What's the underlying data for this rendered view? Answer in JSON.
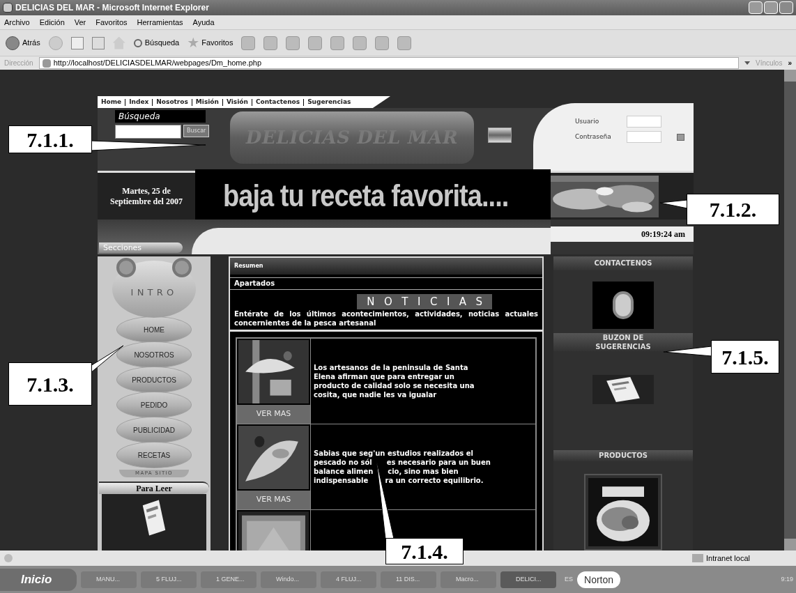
{
  "window": {
    "title": "DELICIAS DEL MAR - Microsoft Internet Explorer"
  },
  "menu": [
    "Archivo",
    "Edición",
    "Ver",
    "Favoritos",
    "Herramientas",
    "Ayuda"
  ],
  "toolbar": {
    "back": "Atrás",
    "search": "Búsqueda",
    "favorites": "Favoritos"
  },
  "address": {
    "label": "Dirección",
    "url": "http://localhost/DELICIASDELMAR/webpages/Dm_home.php",
    "links": "Vínculos",
    "more": "»"
  },
  "page": {
    "nav": [
      "Home",
      "Index",
      "Nosotros",
      "Misión",
      "Visión",
      "Contactenos",
      "Sugerencias"
    ],
    "search": {
      "title": "Búsqueda",
      "button": "Buscar"
    },
    "logo": "DELICIAS DEL MAR",
    "login": {
      "user_label": "Usuario",
      "password_label": "Contraseña"
    },
    "date": [
      "Martes, 25 de",
      "Septiembre del 2007"
    ],
    "slogan": "baja tu receta favorita....",
    "sections_tab": "Secciones",
    "time": "09:19:24 am",
    "side_menu": {
      "title": "INTRO",
      "items": [
        "HOME",
        "NOSOTROS",
        "PRODUCTOS",
        "PEDIDO",
        "PUBLICIDAD",
        "RECETAS"
      ],
      "footer": "MAPA SITIO"
    },
    "reading_title": "Para Leer",
    "summary": "Resumen",
    "subtitle": "Apartados",
    "news_title": "NOTICIAS",
    "intro": "Entérate de los últimos acontecimientos, actividades, noticias actuales concernientes de la pesca artesanal",
    "news": [
      {
        "kind": "article",
        "lines": [
          "Los artesanos de la peninsula de Santa",
          "Elena afirman que para entregar un",
          "producto de calidad solo se necesita una",
          "cosita, que nadie les va igualar"
        ],
        "more": "VER MAS"
      },
      {
        "kind": "article",
        "lines": [
          "Sabias que seg'un estudios realizados el",
          "pescado no sól      es necesario para un buen",
          "balance alimen      cio, sino mas bien",
          "indispensable       ra un correcto equilibrio."
        ],
        "more": "VER MAS"
      },
      {
        "kind": "picture"
      }
    ],
    "right": {
      "contact": "CONTACTENOS",
      "suggestions": [
        "BUZON DE",
        "SUGERENCIAS"
      ],
      "products": "PRODUCTOS"
    }
  },
  "status": {
    "zone": "Intranet local"
  },
  "taskbar": {
    "start": "Inicio",
    "tasks": [
      "MANU...",
      "5 FLUJ...",
      "1 GENE...",
      "Windo...",
      "4 FLUJ...",
      "11 DIS...",
      "Macro...",
      "DELICI..."
    ],
    "language": "ES",
    "antivirus": "Norton",
    "clock": "9:19"
  },
  "callouts": [
    "7.1.1.",
    "7.1.2.",
    "7.1.3.",
    "7.1.4.",
    "7.1.5."
  ]
}
